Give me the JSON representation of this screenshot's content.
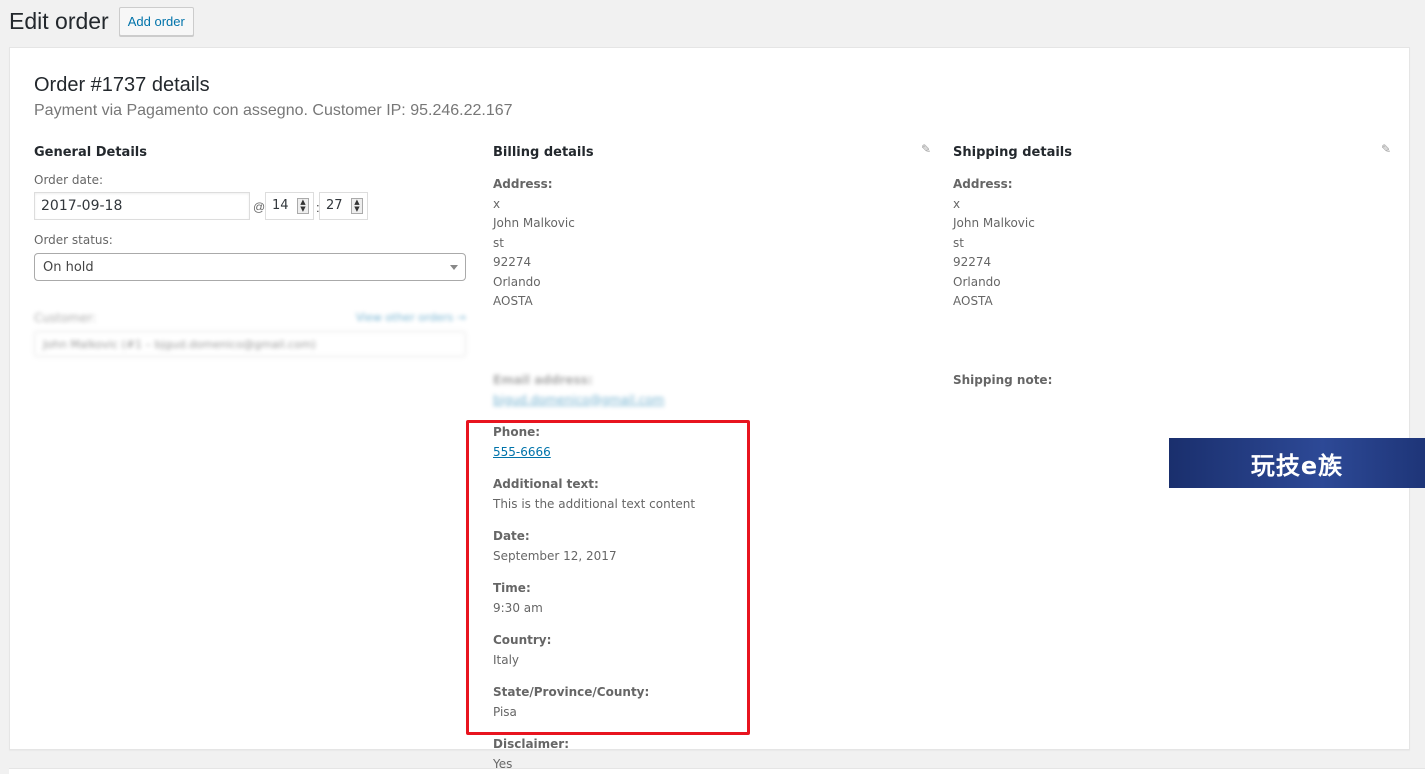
{
  "header": {
    "title": "Edit order",
    "add_button": "Add order"
  },
  "order": {
    "heading": "Order #1737 details",
    "subheading": "Payment via Pagamento con assegno. Customer IP: 95.246.22.167"
  },
  "general": {
    "title": "General Details",
    "order_date_label": "Order date:",
    "order_date": "2017-09-18",
    "at": "@",
    "hour": "14",
    "colon": ":",
    "minute": "27",
    "status_label": "Order status:",
    "status_value": "On hold",
    "customer_label": "Customer:",
    "customer_link": "View other orders →",
    "customer_value": "John Malkovic (#1 – bjgud.domenico@gmail.com)"
  },
  "billing": {
    "title": "Billing details",
    "address_label": "Address:",
    "address_lines": [
      "x",
      "John Malkovic",
      "st",
      "92274",
      "Orlando",
      "AOSTA"
    ],
    "email_label": "Email address:",
    "email_value": "bjgud.domenico@gmail.com",
    "phone_label": "Phone:",
    "phone_value": "555-6666",
    "extra": [
      {
        "label": "Additional text:",
        "value": "This is the additional text content"
      },
      {
        "label": "Date:",
        "value": "September 12, 2017"
      },
      {
        "label": "Time:",
        "value": "9:30 am"
      },
      {
        "label": "Country:",
        "value": "Italy"
      },
      {
        "label": "State/Province/County:",
        "value": "Pisa"
      },
      {
        "label": "Disclaimer:",
        "value": "Yes"
      }
    ]
  },
  "shipping": {
    "title": "Shipping details",
    "address_label": "Address:",
    "address_lines": [
      "x",
      "John Malkovic",
      "st",
      "92274",
      "Orlando",
      "AOSTA"
    ],
    "note_label": "Shipping note:"
  },
  "watermark": {
    "text": "玩技e族"
  },
  "icons": {
    "edit": "pencil-icon"
  },
  "colors": {
    "accent": "#0073aa",
    "highlight": "#e8141f"
  }
}
